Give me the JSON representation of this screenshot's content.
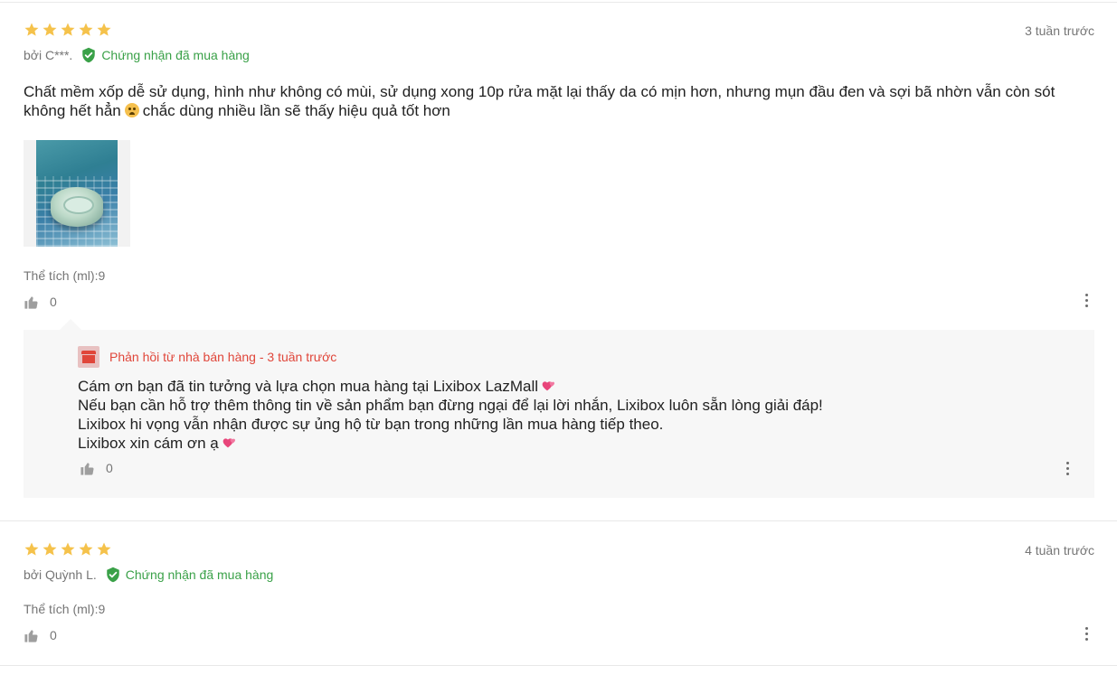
{
  "reviews": [
    {
      "rating": 5,
      "date": "3 tuần trước",
      "author": "bởi C***.",
      "verified_label": "Chứng nhận đã mua hàng",
      "text_before_emoji": "Chất mềm xốp dễ sử dụng, hình như không có mùi, sử dụng xong 10p rửa mặt lại thấy da có mịn hơn, nhưng mụn đầu đen và sợi bã nhờn vẫn còn sót không hết hẳn",
      "text_after_emoji": "chắc dùng nhiều lần sẽ thấy hiệu quả tốt hơn",
      "variant": "Thể tích (ml):9",
      "likes": "0",
      "seller_reply": {
        "title": "Phản hồi từ nhà bán hàng - 3 tuần trước",
        "lines": [
          "Cám ơn bạn đã tin tưởng và lựa chọn mua hàng tại Lixibox LazMall",
          "Nếu bạn cần hỗ trợ thêm thông tin về sản phẩm bạn đừng ngại để lại lời nhắn, Lixibox luôn sẵn lòng giải đáp!",
          "Lixibox hi vọng vẫn nhận được sự ủng hộ từ bạn trong những lần mua hàng tiếp theo.",
          "Lixibox xin cám ơn ạ"
        ],
        "likes": "0"
      }
    },
    {
      "rating": 5,
      "date": "4 tuần trước",
      "author": "bởi Quỳnh L.",
      "verified_label": "Chứng nhận đã mua hàng",
      "variant": "Thể tích (ml):9",
      "likes": "0"
    }
  ],
  "colors": {
    "star": "#f5c24b",
    "verified": "#3aa148",
    "reply_title": "#e0463a",
    "reply_bg": "#f7f7f7",
    "muted_text": "#757575"
  },
  "icons": {
    "star": "star-icon",
    "verified": "shield-check-icon",
    "like": "thumbs-up-icon",
    "more": "more-vertical-icon",
    "store": "store-icon",
    "heart": "two-hearts-emoji",
    "face": "face-emoji"
  }
}
